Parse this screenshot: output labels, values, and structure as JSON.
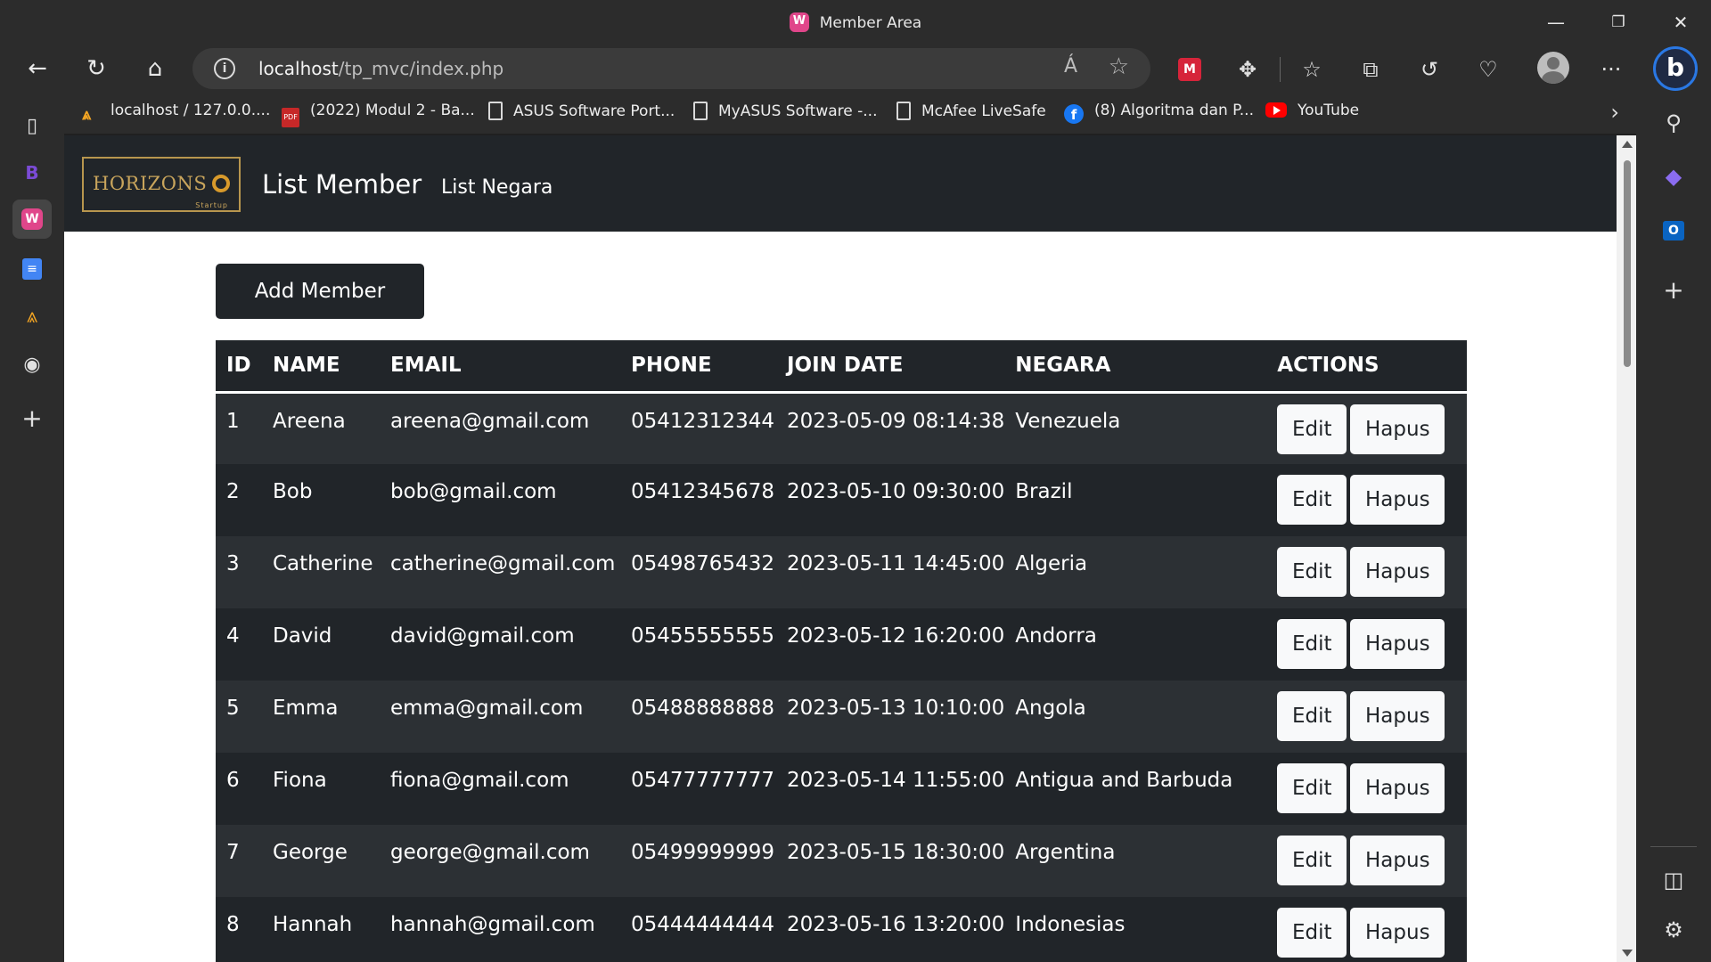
{
  "window": {
    "title": "Member Area",
    "minimize": "—",
    "restore": "❐",
    "close": "✕"
  },
  "toolbar": {
    "back": "←",
    "refresh": "↻",
    "home": "⌂",
    "url_host": "localhost",
    "url_path": "/tp_mvc/index.php",
    "read_aloud": "Á",
    "favorite": "☆",
    "extensions": "✥",
    "favorites": "☆",
    "collections": "⧉",
    "history": "↺",
    "health": "♡",
    "more": "···",
    "bing": "b"
  },
  "bookmarks": [
    {
      "label": "localhost / 127.0.0....",
      "icon": "phpmyadmin-icon"
    },
    {
      "label": "(2022) Modul 2 - Ba...",
      "icon": "pdf-icon"
    },
    {
      "label": "ASUS Software Port...",
      "icon": "document-icon"
    },
    {
      "label": "MyASUS Software -...",
      "icon": "document-icon"
    },
    {
      "label": "McAfee LiveSafe",
      "icon": "document-icon"
    },
    {
      "label": "(8) Algoritma dan P...",
      "icon": "facebook-icon"
    },
    {
      "label": "YouTube",
      "icon": "youtube-icon"
    }
  ],
  "page": {
    "logo_text": "HORIZONS",
    "logo_sub": "Startup",
    "brand": "List Member",
    "nav_link": "List Negara",
    "add_button": "Add Member",
    "columns": [
      "ID",
      "NAME",
      "EMAIL",
      "PHONE",
      "JOIN DATE",
      "NEGARA",
      "ACTIONS"
    ],
    "edit_label": "Edit",
    "delete_label": "Hapus",
    "rows": [
      {
        "id": "1",
        "name": "Areena",
        "email": "areena@gmail.com",
        "phone": "05412312344",
        "join": "2023-05-09 08:14:38",
        "negara": "Venezuela"
      },
      {
        "id": "2",
        "name": "Bob",
        "email": "bob@gmail.com",
        "phone": "05412345678",
        "join": "2023-05-10 09:30:00",
        "negara": "Brazil"
      },
      {
        "id": "3",
        "name": "Catherine",
        "email": "catherine@gmail.com",
        "phone": "05498765432",
        "join": "2023-05-11 14:45:00",
        "negara": "Algeria"
      },
      {
        "id": "4",
        "name": "David",
        "email": "david@gmail.com",
        "phone": "05455555555",
        "join": "2023-05-12 16:20:00",
        "negara": "Andorra"
      },
      {
        "id": "5",
        "name": "Emma",
        "email": "emma@gmail.com",
        "phone": "05488888888",
        "join": "2023-05-13 10:10:00",
        "negara": "Angola"
      },
      {
        "id": "6",
        "name": "Fiona",
        "email": "fiona@gmail.com",
        "phone": "05477777777",
        "join": "2023-05-14 11:55:00",
        "negara": "Antigua and Barbuda"
      },
      {
        "id": "7",
        "name": "George",
        "email": "george@gmail.com",
        "phone": "05499999999",
        "join": "2023-05-15 18:30:00",
        "negara": "Argentina"
      },
      {
        "id": "8",
        "name": "Hannah",
        "email": "hannah@gmail.com",
        "phone": "05444444444",
        "join": "2023-05-16 13:20:00",
        "negara": "Indonesias"
      }
    ]
  },
  "colors": {
    "navbar": "#212529",
    "row_odd": "#2c3034",
    "row_even": "#212529",
    "logo_gold": "#c9a55c"
  }
}
